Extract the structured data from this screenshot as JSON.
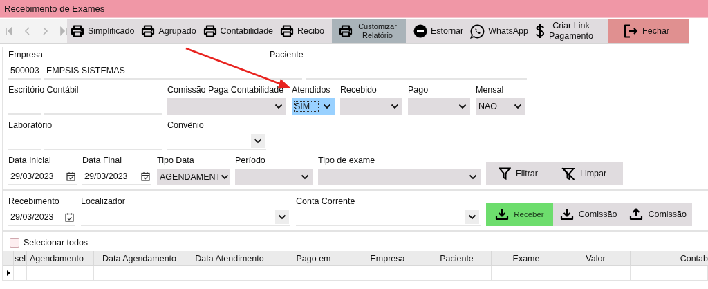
{
  "window": {
    "title": "Recebimento de Exames"
  },
  "toolbar": {
    "nav": [
      {
        "kind": "first",
        "disabled": true
      },
      {
        "kind": "prev",
        "disabled": true
      },
      {
        "kind": "next",
        "disabled": true
      },
      {
        "kind": "last",
        "disabled": true
      }
    ],
    "buttons": [
      {
        "label": "Simplificado",
        "kind": "print"
      },
      {
        "label": "Agrupado",
        "kind": "print"
      },
      {
        "label": "Contabilidade",
        "kind": "print"
      },
      {
        "label": "Recibo",
        "kind": "print"
      },
      {
        "label": "Customizar Relatório",
        "kind": "custom"
      },
      {
        "label": "Estornar",
        "kind": "reverse"
      },
      {
        "label": "WhatsApp",
        "kind": "message"
      },
      {
        "label": "Criar Link Pagamento",
        "kind": "payment"
      },
      {
        "label": "Fechar",
        "kind": "close"
      }
    ]
  },
  "empresa": {
    "label": "Empresa",
    "code": "500003",
    "name": "EMPSIS SISTEMAS"
  },
  "paciente": {
    "label": "Paciente"
  },
  "escritorio_contabil": {
    "label": "Escritório Contábil"
  },
  "comissao_paga": {
    "label": "Comissão Paga Contabilidade"
  },
  "atendidos": {
    "label": "Atendidos",
    "value": "SIM",
    "focused": true
  },
  "recebido": {
    "label": "Recebido",
    "focused": false
  },
  "pago": {
    "label": "Pago",
    "focused": false
  },
  "mensal": {
    "label": "Mensal",
    "value": "NÃO",
    "focused": false
  },
  "laboratorio": {
    "label": "Laboratório"
  },
  "convenio": {
    "label": "Convênio"
  },
  "data_inicial": {
    "label": "Data Inicial",
    "value": "29/03/2023"
  },
  "data_final": {
    "label": "Data Final",
    "value": "29/03/2023"
  },
  "tipo_data": {
    "label": "Tipo Data",
    "value": "AGENDAMENT",
    "focused": false
  },
  "periodo": {
    "label": "Período",
    "focused": false
  },
  "tipo_exame": {
    "label": "Tipo de exame",
    "focused": false
  },
  "filter_buttons": [
    {
      "label": "Filtrar",
      "kind": "filter"
    },
    {
      "label": "Limpar",
      "kind": "clear"
    }
  ],
  "recebimento": {
    "label": "Recebimento",
    "value": "29/03/2023"
  },
  "localizador": {
    "label": "Localizador"
  },
  "conta_corrente": {
    "label": "Conta Corrente"
  },
  "action_buttons": [
    {
      "label": "Receber",
      "kind": "receive"
    },
    {
      "label": "Comissão",
      "kind": "import"
    },
    {
      "label": "Comissão",
      "kind": "export"
    }
  ],
  "select_all": {
    "label": "Selecionar todos",
    "checked": false
  },
  "table": {
    "columns": [
      "sel",
      "Agendamento",
      "Data Agendamento",
      "Data Atendimento",
      "Pago em",
      "Empresa",
      "Paciente",
      "Exame",
      "Valor",
      "Contab"
    ],
    "rows": [
      {
        "current": true
      }
    ]
  }
}
